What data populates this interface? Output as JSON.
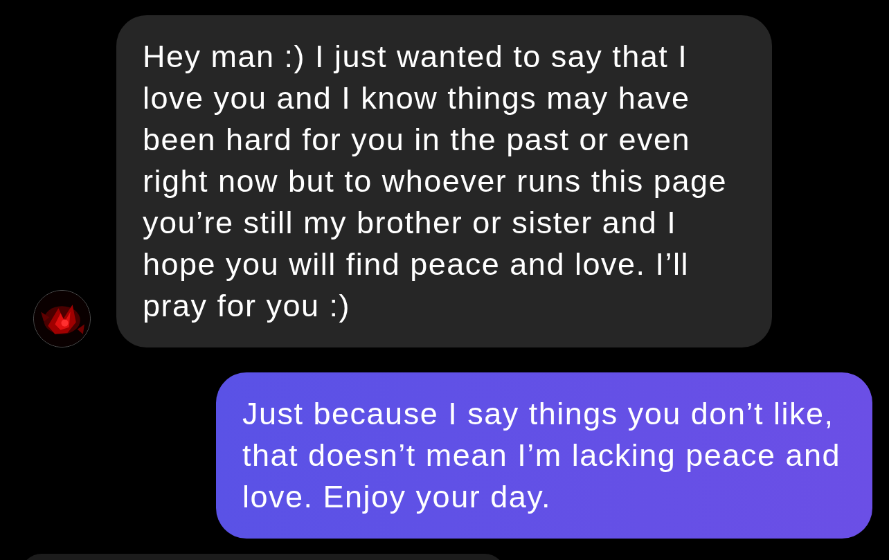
{
  "messages": [
    {
      "kind": "incoming",
      "text": "Hey man :) I just wanted to say that I love you and I know things may have been hard for you in the past or even right now but to whoever runs this page you’re still my brother or sister and I hope you will find peace and love. I’ll pray for you :)"
    },
    {
      "kind": "outgoing",
      "text": "Just because I say things you don’t like, that doesn’t mean I’m lacking peace and love. Enjoy your day."
    }
  ]
}
